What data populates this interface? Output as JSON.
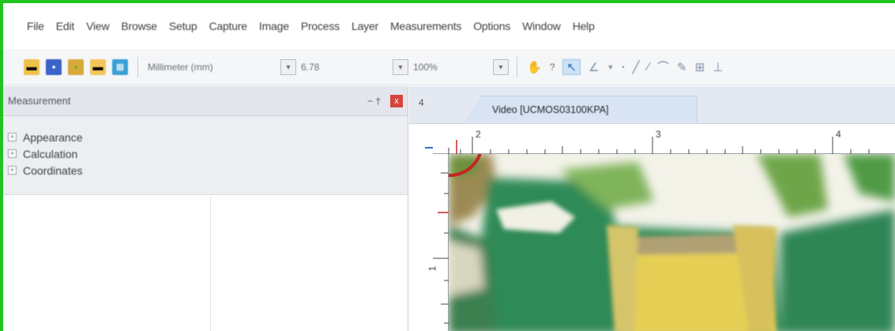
{
  "menubar": {
    "items": [
      "File",
      "Edit",
      "View",
      "Browse",
      "Setup",
      "Capture",
      "Image",
      "Process",
      "Layer",
      "Measurements",
      "Options",
      "Window",
      "Help"
    ]
  },
  "toolbar": {
    "unit_value": "Millimeter (mm)",
    "scale_value": "6.78",
    "zoom_value": "100%",
    "icons": [
      "open-folder-icon",
      "save-icon",
      "save-as-icon",
      "browse-folder-icon",
      "grid-apps-icon"
    ],
    "tools": [
      "hand-pan-icon",
      "select-arrow-icon",
      "angle-tool-icon",
      "point-tool-icon",
      "line-tool-icon",
      "polyline-tool-icon",
      "pen-tool-icon",
      "calibrate-icon",
      "perpendicular-icon"
    ]
  },
  "panel": {
    "title": "Measurement",
    "pin_glyph": "− †",
    "close_glyph": "x",
    "tree_items": [
      {
        "expander": "+",
        "label": "Appearance"
      },
      {
        "expander": "+",
        "label": "Calculation"
      },
      {
        "expander": "+",
        "label": "Coordinates"
      }
    ]
  },
  "document": {
    "nav_glyph": "4",
    "tab_label": "Video [UCMOS03100KPA]",
    "ruler_top_labels": [
      "2",
      "3",
      "4"
    ],
    "ruler_left_labels": [
      "1"
    ]
  },
  "colors": {
    "frame_border": "#21c321",
    "highlight_circle": "#c22522",
    "pcb_green": "#2f8a57",
    "component_yellow": "#e6cf55"
  }
}
